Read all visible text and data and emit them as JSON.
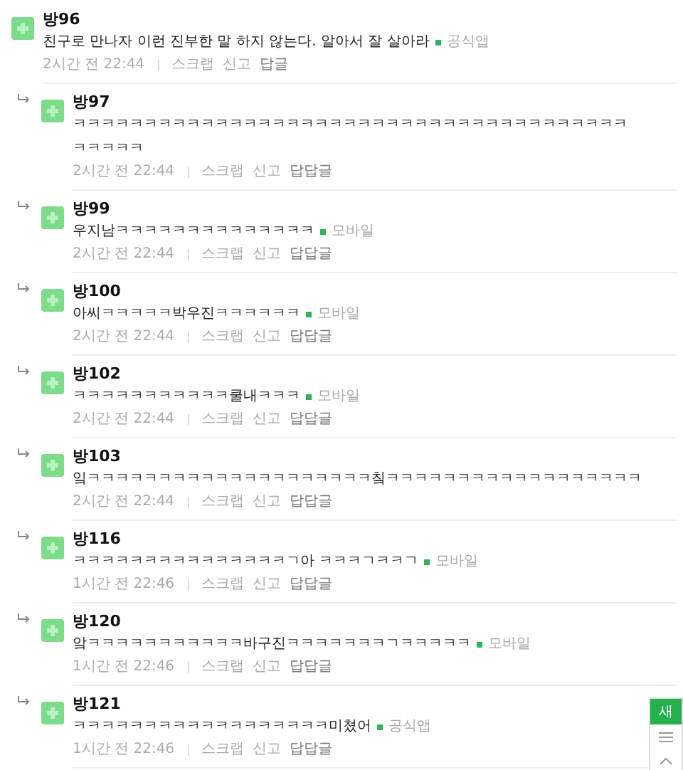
{
  "comments": [
    {
      "kind": "comment",
      "name": "방96",
      "lines": [
        "친구로 만나자 이런 진부한 말 하지 않는다. 알아서 잘 살아라"
      ],
      "source": "공식앱",
      "time": "2시간 전 22:44",
      "actions": [
        "스크랩",
        "신고"
      ],
      "reply": "답글"
    },
    {
      "kind": "reply",
      "name": "방97",
      "lines": [
        "ㅋㅋㅋㅋㅋㅋㅋㅋㅋㅋㅋㅋㅋㅋㅋㅋㅋㅋㅋㅋㅋㅋㅋㅋㅋㅋㅋㅋㅋㅋㅋㅋㅋㅋㅋㅋㅋㅋㅋ",
        "ㅋㅋㅋㅋㅋ"
      ],
      "time": "2시간 전 22:44",
      "actions": [
        "스크랩",
        "신고"
      ],
      "reply": "답답글"
    },
    {
      "kind": "reply",
      "name": "방99",
      "lines": [
        "우지남ㅋㅋㅋㅋㅋㅋㅋㅋㅋㅋㅋㅋㅋㅋ"
      ],
      "source": "모바일",
      "time": "2시간 전 22:44",
      "actions": [
        "스크랩",
        "신고"
      ],
      "reply": "답답글"
    },
    {
      "kind": "reply",
      "name": "방100",
      "lines": [
        "아씨ㅋㅋㅋㅋㅋ박우진ㅋㅋㅋㅋㅋㅋ"
      ],
      "source": "모바일",
      "time": "2시간 전 22:44",
      "actions": [
        "스크랩",
        "신고"
      ],
      "reply": "답답글"
    },
    {
      "kind": "reply",
      "name": "방102",
      "lines": [
        "ㅋㅋㅋㅋㅋㅋㅋㅋㅋㅋㅋ쿨내ㅋㅋㅋ"
      ],
      "source": "모바일",
      "time": "2시간 전 22:44",
      "actions": [
        "스크랩",
        "신고"
      ],
      "reply": "답답글"
    },
    {
      "kind": "reply",
      "name": "방103",
      "lines": [
        "잌ㅋㅋㅋㅋㅋㅋㅋㅋㅋㅋㅋㅋㅋㅋㅋㅋㅋㅋㅋㅋ칰ㅋㅋㅋㅋㅋㅋㅋㅋㅋㅋㅋㅋㅋㅋㅋㅋㅋㅋ"
      ],
      "time": "2시간 전 22:44",
      "actions": [
        "스크랩",
        "신고"
      ],
      "reply": "답답글"
    },
    {
      "kind": "reply",
      "name": "방116",
      "lines": [
        "ㅋㅋㅋㅋㅋㅋㅋㅋㅋㅋㅋㅋㅋㅋㅋㄱ아 ㅋㅋㅋㄱㅋㅋㄱ"
      ],
      "source": "모바일",
      "time": "1시간 전 22:46",
      "actions": [
        "스크랩",
        "신고"
      ],
      "reply": "답답글"
    },
    {
      "kind": "reply",
      "name": "방120",
      "lines": [
        "앜ㅋㅋㅋㅋㅋㅋㅋㅋㅋㅋㅋ바구진ㅋㅋㅋㅋㅋㅋㅋㄱㅋㅋㅋㅋㅋ"
      ],
      "source": "모바일",
      "time": "1시간 전 22:46",
      "actions": [
        "스크랩",
        "신고"
      ],
      "reply": "답답글"
    },
    {
      "kind": "reply",
      "name": "방121",
      "lines": [
        "ㅋㅋㅋㅋㅋㅋㅋㅋㅋㅋㅋㅋㅋㅋㅋㅋㅋㅋ미쳤어"
      ],
      "source": "공식앱",
      "time": "1시간 전 22:46",
      "actions": [
        "스크랩",
        "신고"
      ],
      "reply": "답답글"
    }
  ],
  "floating": {
    "new_label": "새"
  }
}
